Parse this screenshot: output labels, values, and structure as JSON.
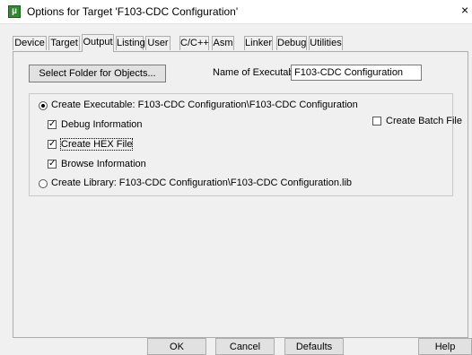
{
  "window": {
    "title": "Options for Target 'F103-CDC Configuration'",
    "app_icon": "µ",
    "close_glyph": "×"
  },
  "tabs": [
    {
      "label": "Device",
      "active": false
    },
    {
      "label": "Target",
      "active": false
    },
    {
      "label": "Output",
      "active": true
    },
    {
      "label": "Listing",
      "active": false
    },
    {
      "label": "User",
      "active": false
    },
    {
      "label": "C/C++",
      "active": false
    },
    {
      "label": "Asm",
      "active": false
    },
    {
      "label": "Linker",
      "active": false
    },
    {
      "label": "Debug",
      "active": false
    },
    {
      "label": "Utilities",
      "active": false
    }
  ],
  "output": {
    "select_folder_label": "Select Folder for Objects...",
    "name_label": "Name of Executable:",
    "name_value": "F103-CDC Configuration",
    "create_executable_label": "Create Executable:  F103-CDC Configuration\\F103-CDC Configuration",
    "create_executable_selected": true,
    "debug_info_label": "Debug Information",
    "debug_info_checked": true,
    "create_hex_label": "Create HEX File",
    "create_hex_checked": true,
    "browse_info_label": "Browse Information",
    "browse_info_checked": true,
    "create_batch_label": "Create Batch File",
    "create_batch_checked": false,
    "create_library_label": "Create Library:  F103-CDC Configuration\\F103-CDC Configuration.lib",
    "create_library_selected": false
  },
  "footer": {
    "ok_label": "OK",
    "cancel_label": "Cancel",
    "defaults_label": "Defaults",
    "help_label": "Help"
  },
  "check_mark": "✓"
}
